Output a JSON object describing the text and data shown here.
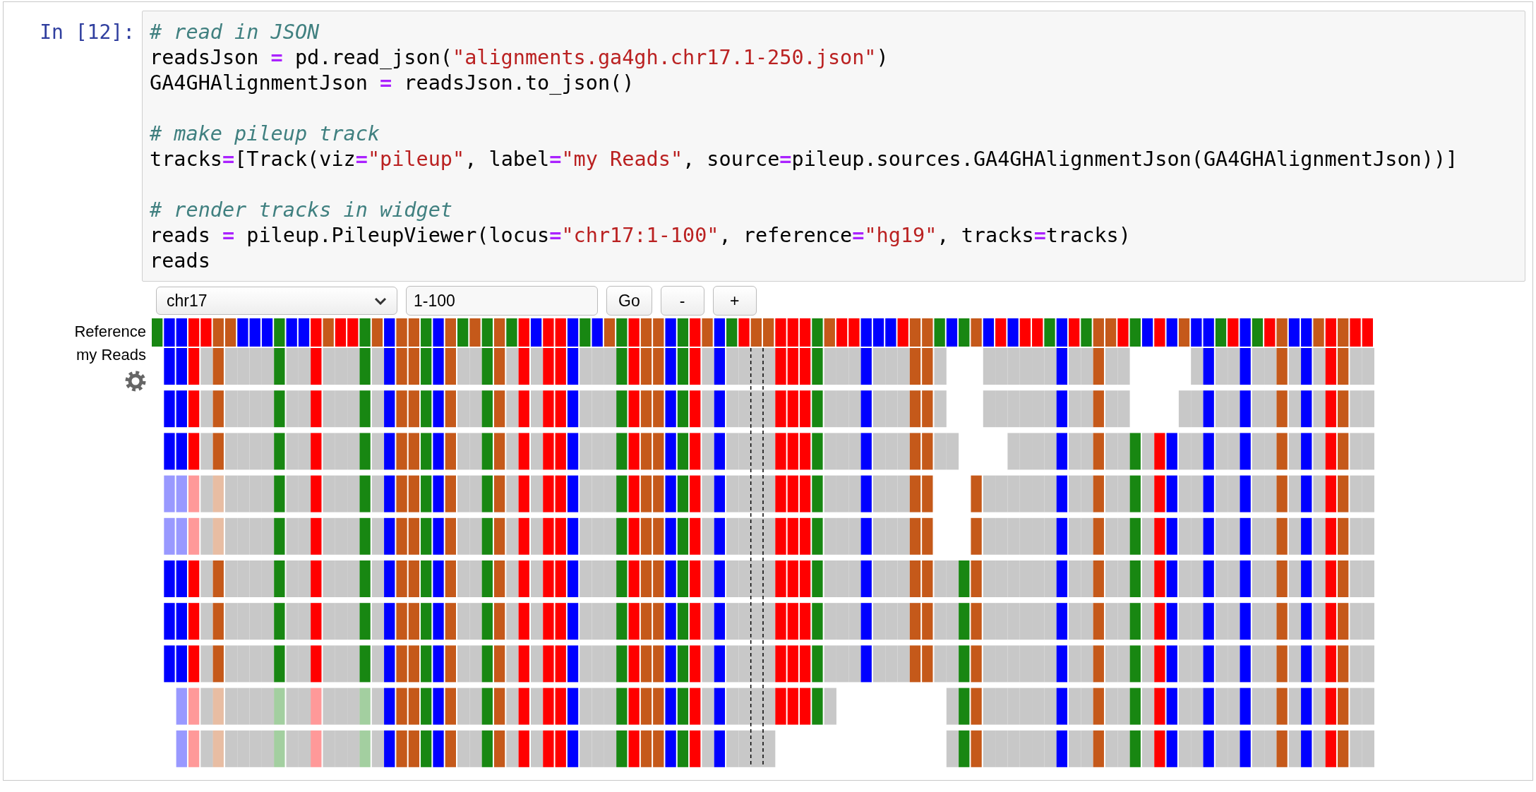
{
  "prompt": "In [12]:",
  "code": [
    {
      "tokens": [
        {
          "kind": "comment",
          "text": "# read in JSON"
        }
      ]
    },
    {
      "tokens": [
        {
          "kind": "plain",
          "text": "readsJson "
        },
        {
          "kind": "op",
          "text": "="
        },
        {
          "kind": "plain",
          "text": " pd.read_json("
        },
        {
          "kind": "string",
          "text": "\"alignments.ga4gh.chr17.1-250.json\""
        },
        {
          "kind": "plain",
          "text": ")"
        }
      ]
    },
    {
      "tokens": [
        {
          "kind": "plain",
          "text": "GA4GHAlignmentJson "
        },
        {
          "kind": "op",
          "text": "="
        },
        {
          "kind": "plain",
          "text": " readsJson.to_json()"
        }
      ]
    },
    {
      "kind": "blank"
    },
    {
      "tokens": [
        {
          "kind": "comment",
          "text": "# make pileup track"
        }
      ]
    },
    {
      "tokens": [
        {
          "kind": "plain",
          "text": "tracks"
        },
        {
          "kind": "op",
          "text": "="
        },
        {
          "kind": "plain",
          "text": "[Track(viz"
        },
        {
          "kind": "op",
          "text": "="
        },
        {
          "kind": "string",
          "text": "\"pileup\""
        },
        {
          "kind": "plain",
          "text": ", label"
        },
        {
          "kind": "op",
          "text": "="
        },
        {
          "kind": "string",
          "text": "\"my Reads\""
        },
        {
          "kind": "plain",
          "text": ", source"
        },
        {
          "kind": "op",
          "text": "="
        },
        {
          "kind": "plain",
          "text": "pileup.sources.GA4GHAlignmentJson(GA4GHAlignmentJson))]"
        }
      ]
    },
    {
      "kind": "blank"
    },
    {
      "tokens": [
        {
          "kind": "comment",
          "text": "# render tracks in widget"
        }
      ]
    },
    {
      "tokens": [
        {
          "kind": "plain",
          "text": "reads "
        },
        {
          "kind": "op",
          "text": "="
        },
        {
          "kind": "plain",
          "text": " pileup.PileupViewer(locus"
        },
        {
          "kind": "op",
          "text": "="
        },
        {
          "kind": "string",
          "text": "\"chr17:1-100\""
        },
        {
          "kind": "plain",
          "text": ", reference"
        },
        {
          "kind": "op",
          "text": "="
        },
        {
          "kind": "string",
          "text": "\"hg19\""
        },
        {
          "kind": "plain",
          "text": ", tracks"
        },
        {
          "kind": "op",
          "text": "="
        },
        {
          "kind": "plain",
          "text": "tracks)"
        }
      ]
    },
    {
      "tokens": [
        {
          "kind": "plain",
          "text": "reads"
        }
      ]
    }
  ],
  "viewer": {
    "contig": {
      "value": "chr17"
    },
    "range": {
      "value": "1-100"
    },
    "buttons": [
      "Go",
      "-",
      "+"
    ],
    "tracks": [
      {
        "kind": "reference",
        "label": "Reference"
      },
      {
        "kind": "reads",
        "label": "my Reads"
      }
    ]
  }
}
